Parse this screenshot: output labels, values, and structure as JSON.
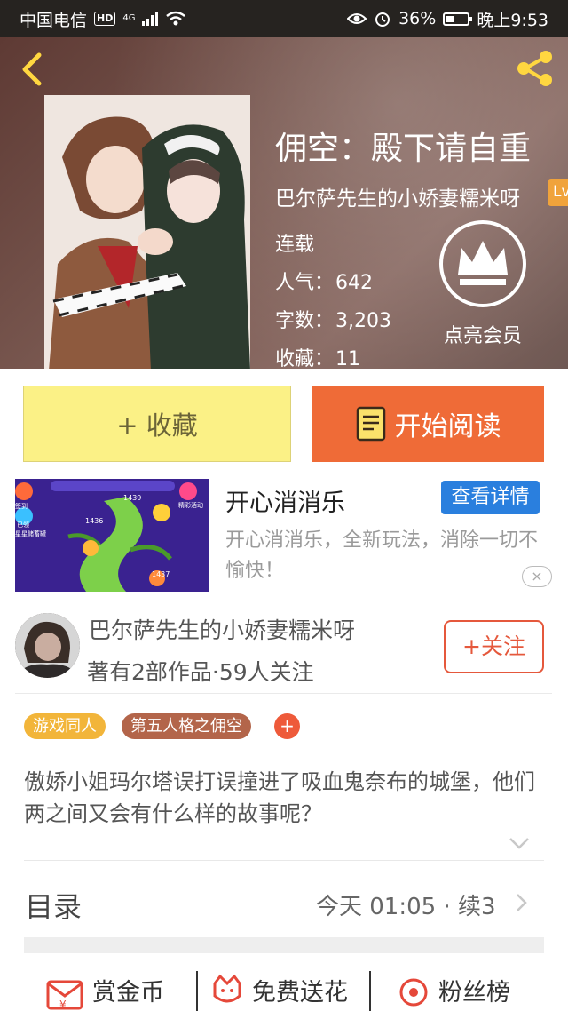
{
  "status_bar": {
    "carrier": "中国电信",
    "hd": "HD",
    "network": "4G",
    "battery": "36%",
    "time": "晚上9:53"
  },
  "book": {
    "title": "佣空：殿下请自重",
    "author": "巴尔萨先生的小娇妻糯米呀",
    "level_badge": "Lv",
    "status": "连载",
    "popularity_label": "人气：",
    "popularity": "642",
    "wordcount_label": "字数：",
    "wordcount": "3,203",
    "favorites_label": "收藏：",
    "favorites": "11",
    "vip_label": "点亮会员"
  },
  "actions": {
    "favorite_label": "+ 收藏",
    "read_label": "开始阅读"
  },
  "ad": {
    "title": "开心消消乐",
    "detail_button": "查看详情",
    "description": "开心消消乐，全新玩法，消除一切不愉快！",
    "close": "×",
    "thumb_texts": [
      "签到",
      "已领",
      "星星储蓄罐",
      "精彩活动",
      "1439",
      "1436",
      "1437"
    ]
  },
  "author_card": {
    "name": "巴尔萨先生的小娇妻糯米呀",
    "stats": "著有2部作品·59人关注",
    "follow_label": "+关注"
  },
  "tags": [
    {
      "label": "游戏同人",
      "color": "#f2b53a"
    },
    {
      "label": "第五人格之佣空",
      "color": "#b3654a"
    }
  ],
  "tag_add": "+",
  "synopsis": "傲娇小姐玛尔塔误打误撞进了吸血鬼奈布的城堡，他们两之间又会有什么样的故事呢？",
  "catalog": {
    "title": "目录",
    "update": "今天 01:05 · 续3"
  },
  "bottom_actions": [
    {
      "label": "赏金币",
      "icon": "red-envelope-icon"
    },
    {
      "label": "免费送花",
      "icon": "flower-icon"
    },
    {
      "label": "粉丝榜",
      "icon": "ranking-icon"
    }
  ],
  "colors": {
    "accent_orange": "#ef6b37",
    "favorite_yellow": "#fbf186",
    "detail_blue": "#2a7fde",
    "follow_red": "#e5583c"
  }
}
